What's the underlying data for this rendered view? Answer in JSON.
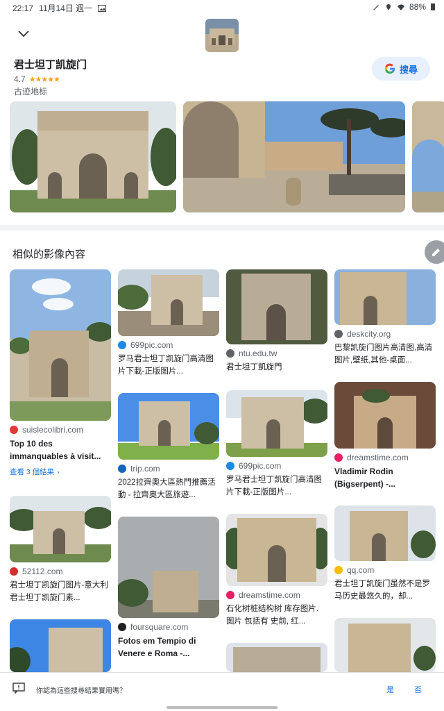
{
  "status_bar": {
    "time": "22:17",
    "date": "11月14日 週一",
    "battery": "88%"
  },
  "entity": {
    "title": "君士坦丁凯旋门",
    "rating": "4.7",
    "stars": "★★★★★",
    "category": "古迹地标"
  },
  "search_button": {
    "label": "搜尋"
  },
  "section": {
    "title": "相似的影像內容"
  },
  "cards": [
    {
      "source": "suislecolibri.com",
      "title": "Top 10 des immanquables à visit...",
      "more": "查看 3 個結果",
      "source_color": "#e53935"
    },
    {
      "source": "52112.com",
      "title": "君士坦丁凯旋门图片-意大利君士坦丁凯旋门素...",
      "source_color": "#d32f2f"
    },
    {
      "source": "699pic.com",
      "title": "罗马君士坦丁凯旋门高清图片下載-正版图片...",
      "source_color": "#1e88e5"
    },
    {
      "source": "trip.com",
      "title": "2022拉齊奧大區熱門推薦活動 - 拉齊奧大區旅遊...",
      "source_color": "#1565c0"
    },
    {
      "source": "foursquare.com",
      "title": "Fotos em Tempio di Venere e Roma -...",
      "source_color": "#202124"
    },
    {
      "source": "ntu.edu.tw",
      "title": "君士坦丁凱旋門",
      "source_color": "#5f6368"
    },
    {
      "source": "699pic.com",
      "title": "罗马君士坦丁凯旋门高清图片下載-正版图片...",
      "source_color": "#1e88e5"
    },
    {
      "source": "dreamstime.com",
      "title": "石化树桩结构树 库存图片. 图片 包括有 史前, 红...",
      "source_color": "#e91e63"
    },
    {
      "source": "deskcity.org",
      "title": "巴黎凯旋门图片高清图,高清图片,壁纸,其他-桌面...",
      "source_color": "#5f6368"
    },
    {
      "source": "dreamstime.com",
      "title": "Vladimir Rodin (Bigserpent) -...",
      "source_color": "#e91e63"
    },
    {
      "source": "qq.com",
      "title": "君士坦丁凯旋门虽然不是罗马历史最悠久的，却...",
      "source_color": "#fbbc04"
    }
  ],
  "footer": {
    "question": "你認為這些搜尋結果實用嗎？",
    "yes": "是",
    "no": "否"
  },
  "colors": {
    "accent": "#1a73e8",
    "star": "#f4a11d"
  }
}
